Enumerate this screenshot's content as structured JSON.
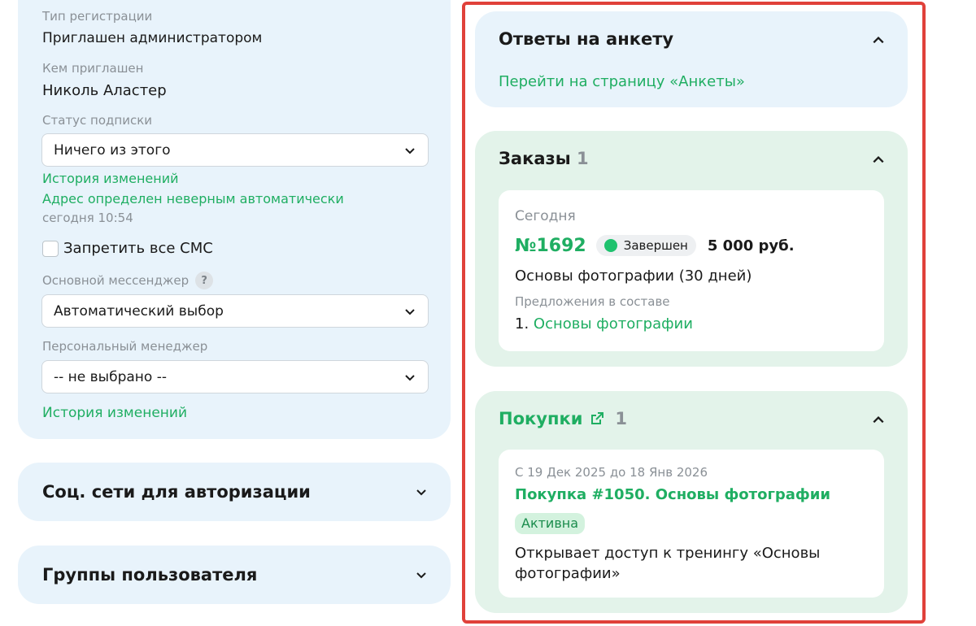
{
  "profile": {
    "registration_type_label": "Тип регистрации",
    "registration_type_value": "Приглашен администратором",
    "invited_by_label": "Кем приглашен",
    "invited_by_value": "Николь Аластер",
    "subscription_status_label": "Статус подписки",
    "subscription_status_value": "Ничего из этого",
    "history_link_1": "История изменений",
    "address_note": "Адрес определен неверным автоматически",
    "address_time": "сегодня 10:54",
    "sms_block_label": "Запретить все СМС",
    "messenger_label": "Основной мессенджер",
    "messenger_help": "?",
    "messenger_value": "Автоматический выбор",
    "manager_label": "Персональный менеджер",
    "manager_value": "-- не выбрано --",
    "history_link_2": "История изменений"
  },
  "social": {
    "title": "Соц. сети для авторизации"
  },
  "groups": {
    "title": "Группы пользователя"
  },
  "questionnaire": {
    "title": "Ответы на анкету",
    "link": "Перейти на страницу «Анкеты»"
  },
  "orders": {
    "title": "Заказы",
    "count": "1",
    "item": {
      "date": "Сегодня",
      "number": "№1692",
      "status": "Завершен",
      "price": "5 000 руб.",
      "product": "Основы фотографии (30 дней)",
      "offers_label": "Предложения в составе",
      "offer_index": "1.",
      "offer_link": "Основы фотографии"
    }
  },
  "purchases": {
    "title": "Покупки",
    "count": "1",
    "item": {
      "period": "С 19 Дек 2025 до 18 Янв 2026",
      "name": "Покупка #1050. Основы фотографии",
      "status": "Активна",
      "description": "Открывает доступ к тренингу «Основы фотографии»"
    }
  },
  "colors": {
    "accent_green": "#1fae62",
    "card_blue": "#e8f3fb",
    "card_green": "#e3f3ea",
    "highlight_red": "#e0413a"
  }
}
